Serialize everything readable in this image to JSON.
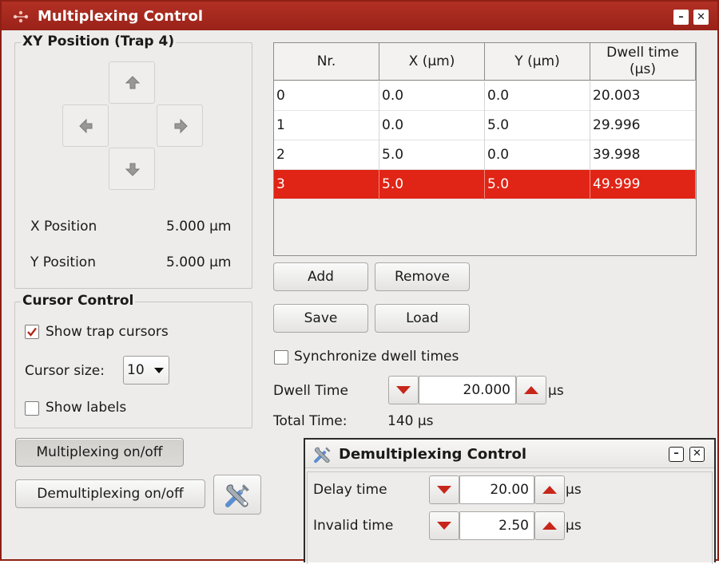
{
  "window": {
    "title": "Multiplexing Control",
    "minimize_glyph": "–",
    "close_glyph": "✕",
    "icon": "multiplexing-app-icon"
  },
  "xy_position": {
    "group_title": "XY Position (Trap 4)",
    "x_label": "X Position",
    "x_value": "5.000 µm",
    "y_label": "Y Position",
    "y_value": "5.000 µm",
    "arrows": [
      "arrow-up-icon",
      "arrow-left-icon",
      "arrow-right-icon",
      "arrow-down-icon"
    ]
  },
  "cursor_control": {
    "group_title": "Cursor Control",
    "show_trap_cursors_label": "Show trap cursors",
    "show_trap_cursors_checked": true,
    "cursor_size_label": "Cursor size:",
    "cursor_size_value": "10",
    "show_labels_label": "Show labels",
    "show_labels_checked": false
  },
  "left_buttons": {
    "multiplexing": "Multiplexing on/off",
    "demultiplexing": "Demultiplexing on/off",
    "tools_icon": "tools-icon"
  },
  "table": {
    "headers": [
      "Nr.",
      "X (µm)",
      "Y (µm)",
      "Dwell time\n(µs)"
    ],
    "rows": [
      [
        "0",
        "0.0",
        "0.0",
        "20.003"
      ],
      [
        "1",
        "0.0",
        "5.0",
        "29.996"
      ],
      [
        "2",
        "5.0",
        "0.0",
        "39.998"
      ],
      [
        "3",
        "5.0",
        "5.0",
        "49.999"
      ]
    ],
    "selected_row": 3,
    "selected_color": "#e02415"
  },
  "table_buttons": {
    "add": "Add",
    "remove": "Remove",
    "save": "Save",
    "load": "Load"
  },
  "dwell": {
    "sync_label": "Synchronize dwell times",
    "sync_checked": false,
    "dwell_label": "Dwell Time",
    "dwell_value": "20.000",
    "dwell_unit": "µs",
    "total_label": "Total Time:",
    "total_value": "140 µs"
  },
  "demux_window": {
    "title": "Demultiplexing Control",
    "minimize_glyph": "–",
    "close_glyph": "✕",
    "delay_label": "Delay time",
    "delay_value": "20.00",
    "delay_unit": "µs",
    "invalid_label": "Invalid time",
    "invalid_value": "2.50",
    "invalid_unit": "µs"
  },
  "colors": {
    "titlebar": "#a3261b",
    "accent_red": "#e02415",
    "window_bg": "#edeceb"
  }
}
